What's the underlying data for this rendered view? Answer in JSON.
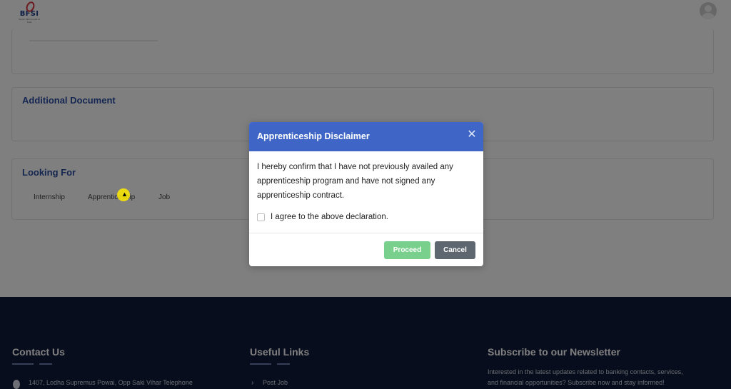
{
  "header": {
    "logo_text": "BFSI",
    "logo_sub": "Sector Skill Council of India"
  },
  "cards": {
    "additional_document_title": "Additional Document",
    "looking_for_title": "Looking For",
    "looking_for_options": [
      "Internship",
      "Apprenticeship",
      "Job"
    ]
  },
  "footer": {
    "contact_title": "Contact Us",
    "contact_address": "1407, Lodha Supremus Powai, Opp Saki Vihar Telephone",
    "links_title": "Useful Links",
    "links": [
      "Post Job"
    ],
    "newsletter_title": "Subscribe to our Newsletter",
    "newsletter_text_line1": "Interested in the latest updates related to banking contacts, services,",
    "newsletter_text_line2": "and financial opportunities? Subscribe now and stay informed!"
  },
  "modal": {
    "title": "Apprenticeship Disclaimer",
    "close_glyph": "✕",
    "body": "I hereby confirm that I have not previously availed any apprenticeship program and have not signed any apprenticeship contract.",
    "agree_label": "I agree to the above declaration.",
    "agree_checked": false,
    "proceed_label": "Proceed",
    "cancel_label": "Cancel"
  },
  "colors": {
    "modal_header": "#3f66c6",
    "proceed": "#79d08c",
    "cancel": "#5e6670",
    "footer_bg": "#0f1a38",
    "heading_blue": "#2b4ea3"
  }
}
